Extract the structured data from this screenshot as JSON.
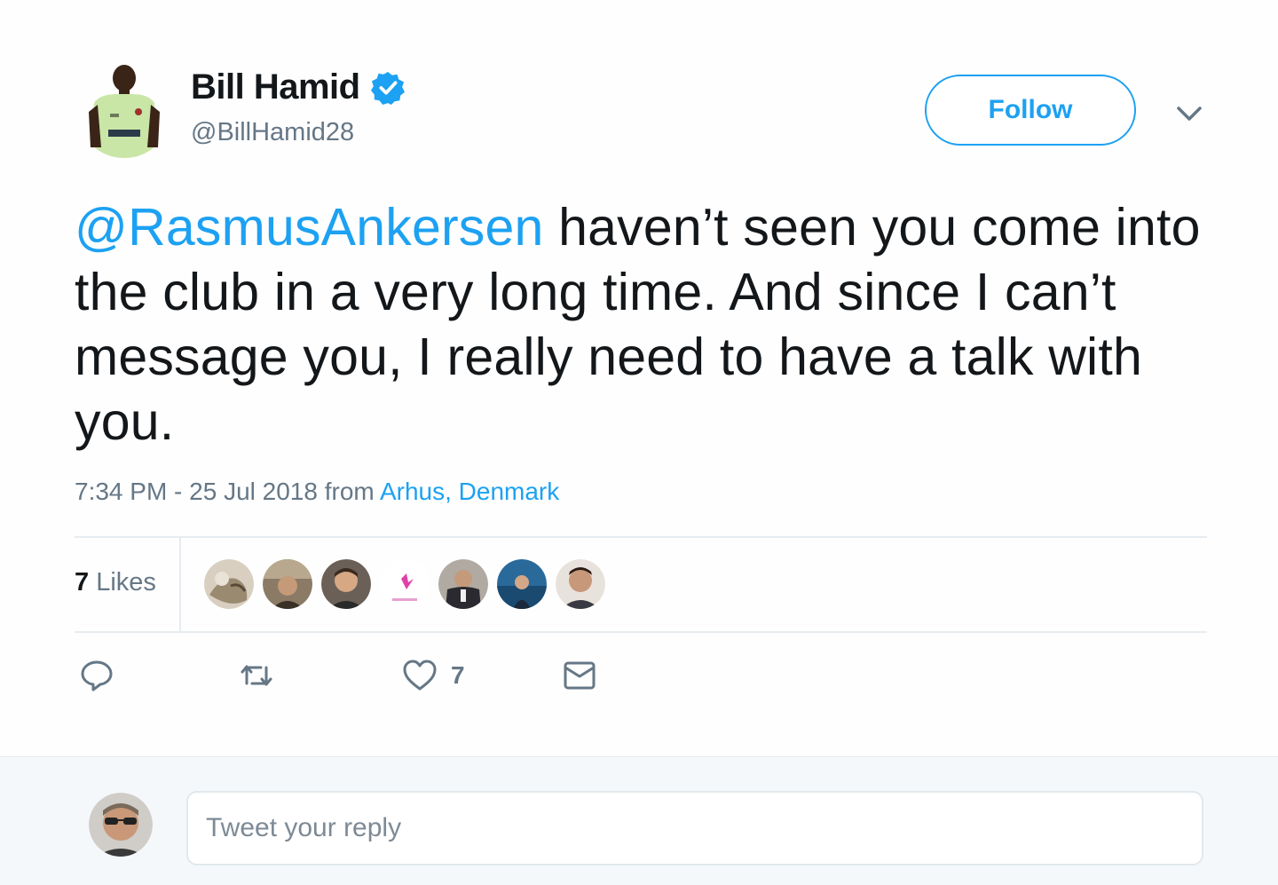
{
  "author": {
    "name": "Bill Hamid",
    "handle": "@BillHamid28",
    "verified": true
  },
  "follow_button": {
    "label": "Follow"
  },
  "tweet": {
    "mention": "@RasmusAnkersen",
    "text": " haven’t seen you come into the club in a very long time. And since I can’t message you, I really need to have a talk with you.",
    "timestamp": "7:34 PM - 25 Jul 2018",
    "from_label": " from ",
    "location": "Arhus, Denmark"
  },
  "likes": {
    "count": "7",
    "label": " Likes",
    "avatars": [
      "liker-1",
      "liker-2",
      "liker-3",
      "liker-4",
      "liker-5",
      "liker-6",
      "liker-7",
      "liker-8"
    ]
  },
  "actions": {
    "reply_icon": "reply-icon",
    "retweet_icon": "retweet-icon",
    "like_icon": "heart-icon",
    "like_count": "7",
    "dm_icon": "envelope-icon"
  },
  "reply": {
    "placeholder": "Tweet your reply"
  },
  "colors": {
    "accent": "#1da1f2",
    "text": "#14171a",
    "muted": "#657786",
    "border": "#e6ecf0",
    "reply_bg": "#f5f8fa"
  }
}
